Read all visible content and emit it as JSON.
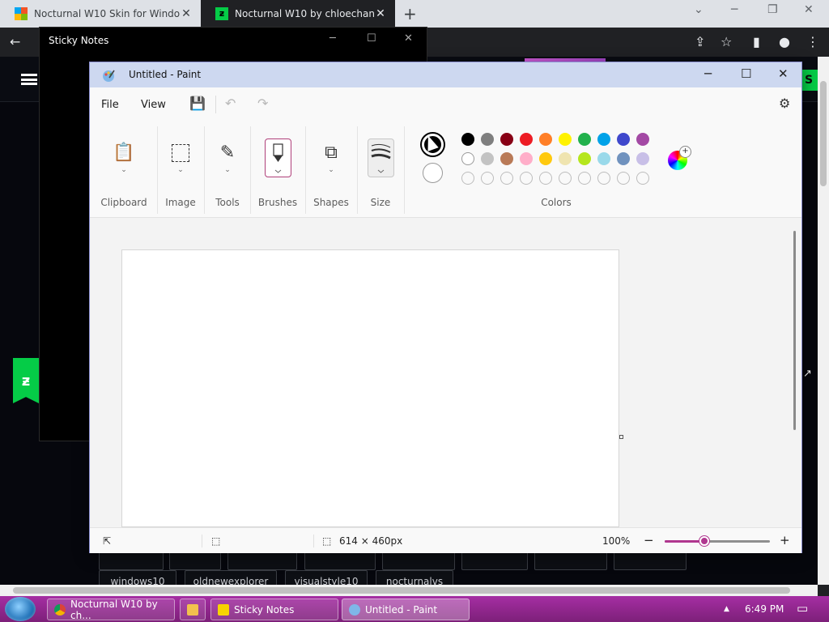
{
  "browser": {
    "tabs": [
      {
        "title": "Nocturnal W10 Skin for Window"
      },
      {
        "title": "Nocturnal W10 by chloechantelle"
      }
    ],
    "new_tab": "+",
    "window_controls": {
      "collapse": "⌄",
      "minimize": "─",
      "restore": "❐",
      "close": "✕"
    },
    "nav": {
      "back": "←",
      "share": "⇪",
      "bookmark": "☆",
      "sidepanel": "▮",
      "profile": "●",
      "menu": "⋮"
    }
  },
  "webpage": {
    "header_button": "S",
    "deviantart_logo": "ƶ",
    "tags_row1": [
      "",
      "",
      "",
      "",
      "",
      "",
      "",
      ""
    ],
    "tags_row2": [
      "windows10",
      "oldnewexplorer",
      "visualstyle10",
      "nocturnalvs"
    ],
    "expand_icon": "↗"
  },
  "sticky_notes": {
    "title": "Sticky Notes",
    "controls": {
      "minimize": "─",
      "maximize": "☐",
      "close": "✕"
    }
  },
  "paint": {
    "title": "Untitled - Paint",
    "controls": {
      "minimize": "─",
      "maximize": "☐",
      "close": "✕"
    },
    "menu": {
      "file": "File",
      "view": "View"
    },
    "quick": {
      "save": "💾",
      "undo": "↶",
      "redo": "↷",
      "settings": "⚙"
    },
    "groups": {
      "clipboard": "Clipboard",
      "image": "Image",
      "tools": "Tools",
      "brushes": "Brushes",
      "shapes": "Shapes",
      "size": "Size",
      "colors": "Colors"
    },
    "palette": {
      "row1": [
        "#000000",
        "#7f7f7f",
        "#880015",
        "#ed1c24",
        "#ff7f27",
        "#fff200",
        "#22b14c",
        "#00a2e8",
        "#3f48cc",
        "#a349a4"
      ],
      "row2": [
        "#ffffff",
        "#c3c3c3",
        "#b97a57",
        "#ffaec9",
        "#ffc90e",
        "#efe4b0",
        "#b5e61d",
        "#99d9ea",
        "#7092be",
        "#c8bfe7"
      ],
      "row3_empty": 10
    },
    "status": {
      "canvas_size": "614 × 460px",
      "zoom": "100%",
      "zoom_minus": "−",
      "zoom_plus": "+",
      "zoom_level_fraction": 0.38
    }
  },
  "taskbar": {
    "buttons": [
      {
        "label": "Nocturnal W10 by ch..."
      },
      {
        "label": "Sticky Notes"
      },
      {
        "label": "Untitled - Paint"
      }
    ],
    "tray_arrow": "▲",
    "clock": "6:49 PM",
    "notification": "▭"
  }
}
